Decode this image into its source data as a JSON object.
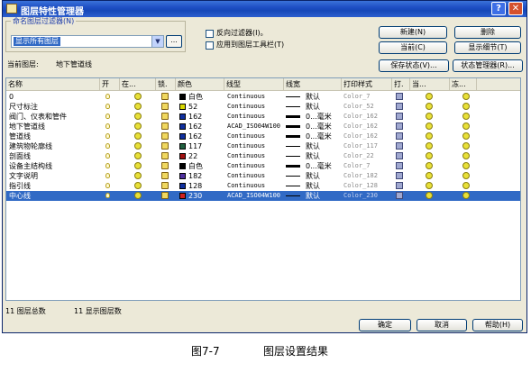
{
  "window": {
    "title": "图层特性管理器",
    "help_btn": "?",
    "close_btn": "✕"
  },
  "filter": {
    "group_title": "命名图层过滤器(N)",
    "combo_value": "显示所有图层",
    "combo_arrow": "▼",
    "browse_btn": "...",
    "invert_label": "反向过滤器(I)。",
    "apply_toolbar_label": "应用到图层工具栏(T)"
  },
  "buttons": {
    "new": "新建(N)",
    "delete": "删除",
    "current": "当前(C)",
    "show_details": "显示细节(T)",
    "save_state": "保存状态(V)...",
    "state_manager": "状态管理器(R)..."
  },
  "current_layer": {
    "label": "当前图层:",
    "value": "地下管道线"
  },
  "columns": [
    "名称",
    "开",
    "在...",
    "锁.",
    "颜色",
    "线型",
    "线宽",
    "打印样式",
    "打.",
    "当...",
    "冻..."
  ],
  "layers": [
    {
      "name": "0",
      "color_hex": "#000000",
      "color_name": "白色",
      "linetype": "Continuous",
      "lineweight": "默认",
      "lw_heavy": false,
      "plot_style": "Color_7",
      "selected": false
    },
    {
      "name": "尺寸标注",
      "color_hex": "#d8d800",
      "color_name": "52",
      "linetype": "Continuous",
      "lineweight": "默认",
      "lw_heavy": false,
      "plot_style": "Color_52",
      "selected": false
    },
    {
      "name": "阀门、仪表和管件",
      "color_hex": "#1030a0",
      "color_name": "162",
      "linetype": "Continuous",
      "lineweight": "0...毫米",
      "lw_heavy": true,
      "plot_style": "Color_162",
      "selected": false
    },
    {
      "name": "地下管道线",
      "color_hex": "#1030a0",
      "color_name": "162",
      "linetype": "ACAD_ISO04W100",
      "lineweight": "0...毫米",
      "lw_heavy": true,
      "plot_style": "Color_162",
      "selected": false
    },
    {
      "name": "管道线",
      "color_hex": "#1030a0",
      "color_name": "162",
      "linetype": "Continuous",
      "lineweight": "0...毫米",
      "lw_heavy": true,
      "plot_style": "Color_162",
      "selected": false
    },
    {
      "name": "建筑物轮廓线",
      "color_hex": "#206040",
      "color_name": "117",
      "linetype": "Continuous",
      "lineweight": "默认",
      "lw_heavy": false,
      "plot_style": "Color_117",
      "selected": false
    },
    {
      "name": "剖面线",
      "color_hex": "#a01010",
      "color_name": "22",
      "linetype": "Continuous",
      "lineweight": "默认",
      "lw_heavy": false,
      "plot_style": "Color_22",
      "selected": false
    },
    {
      "name": "设备主结构线",
      "color_hex": "#000000",
      "color_name": "白色",
      "linetype": "Continuous",
      "lineweight": "0...毫米",
      "lw_heavy": true,
      "plot_style": "Color_7",
      "selected": false
    },
    {
      "name": "文字说明",
      "color_hex": "#5030a0",
      "color_name": "182",
      "linetype": "Continuous",
      "lineweight": "默认",
      "lw_heavy": false,
      "plot_style": "Color_182",
      "selected": false
    },
    {
      "name": "指引线",
      "color_hex": "#1030a0",
      "color_name": "128",
      "linetype": "Continuous",
      "lineweight": "默认",
      "lw_heavy": false,
      "plot_style": "Color_128",
      "selected": false
    },
    {
      "name": "中心线",
      "color_hex": "#d02020",
      "color_name": "230",
      "linetype": "ACAD_ISO04W100",
      "lineweight": "默认",
      "lw_heavy": false,
      "plot_style": "Color_230",
      "selected": true
    }
  ],
  "status": {
    "total": "11 图层总数",
    "shown": "11 显示图层数"
  },
  "dialog_buttons": {
    "ok": "确定",
    "cancel": "取消",
    "help": "帮助(H)"
  },
  "caption": {
    "figure": "图7-7",
    "text": "图层设置结果"
  }
}
